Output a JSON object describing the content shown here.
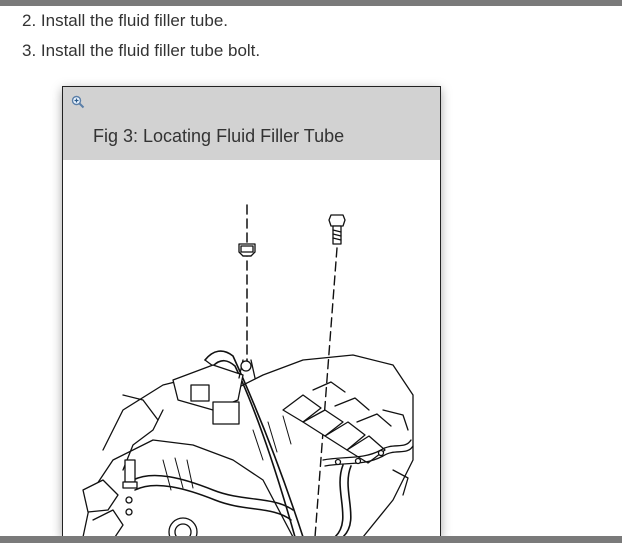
{
  "steps": [
    "2. Install the fluid filler tube.",
    "3. Install the fluid filler tube bolt."
  ],
  "figure": {
    "caption": "Fig 3: Locating Fluid Filler Tube",
    "zoom_icon": "zoom-in-icon",
    "image_subject": "engine-fluid-filler-tube-line-drawing"
  },
  "colors": {
    "frame_bars": "#7a7a7a",
    "caption_band": "#d2d2d2",
    "text": "#333333"
  }
}
